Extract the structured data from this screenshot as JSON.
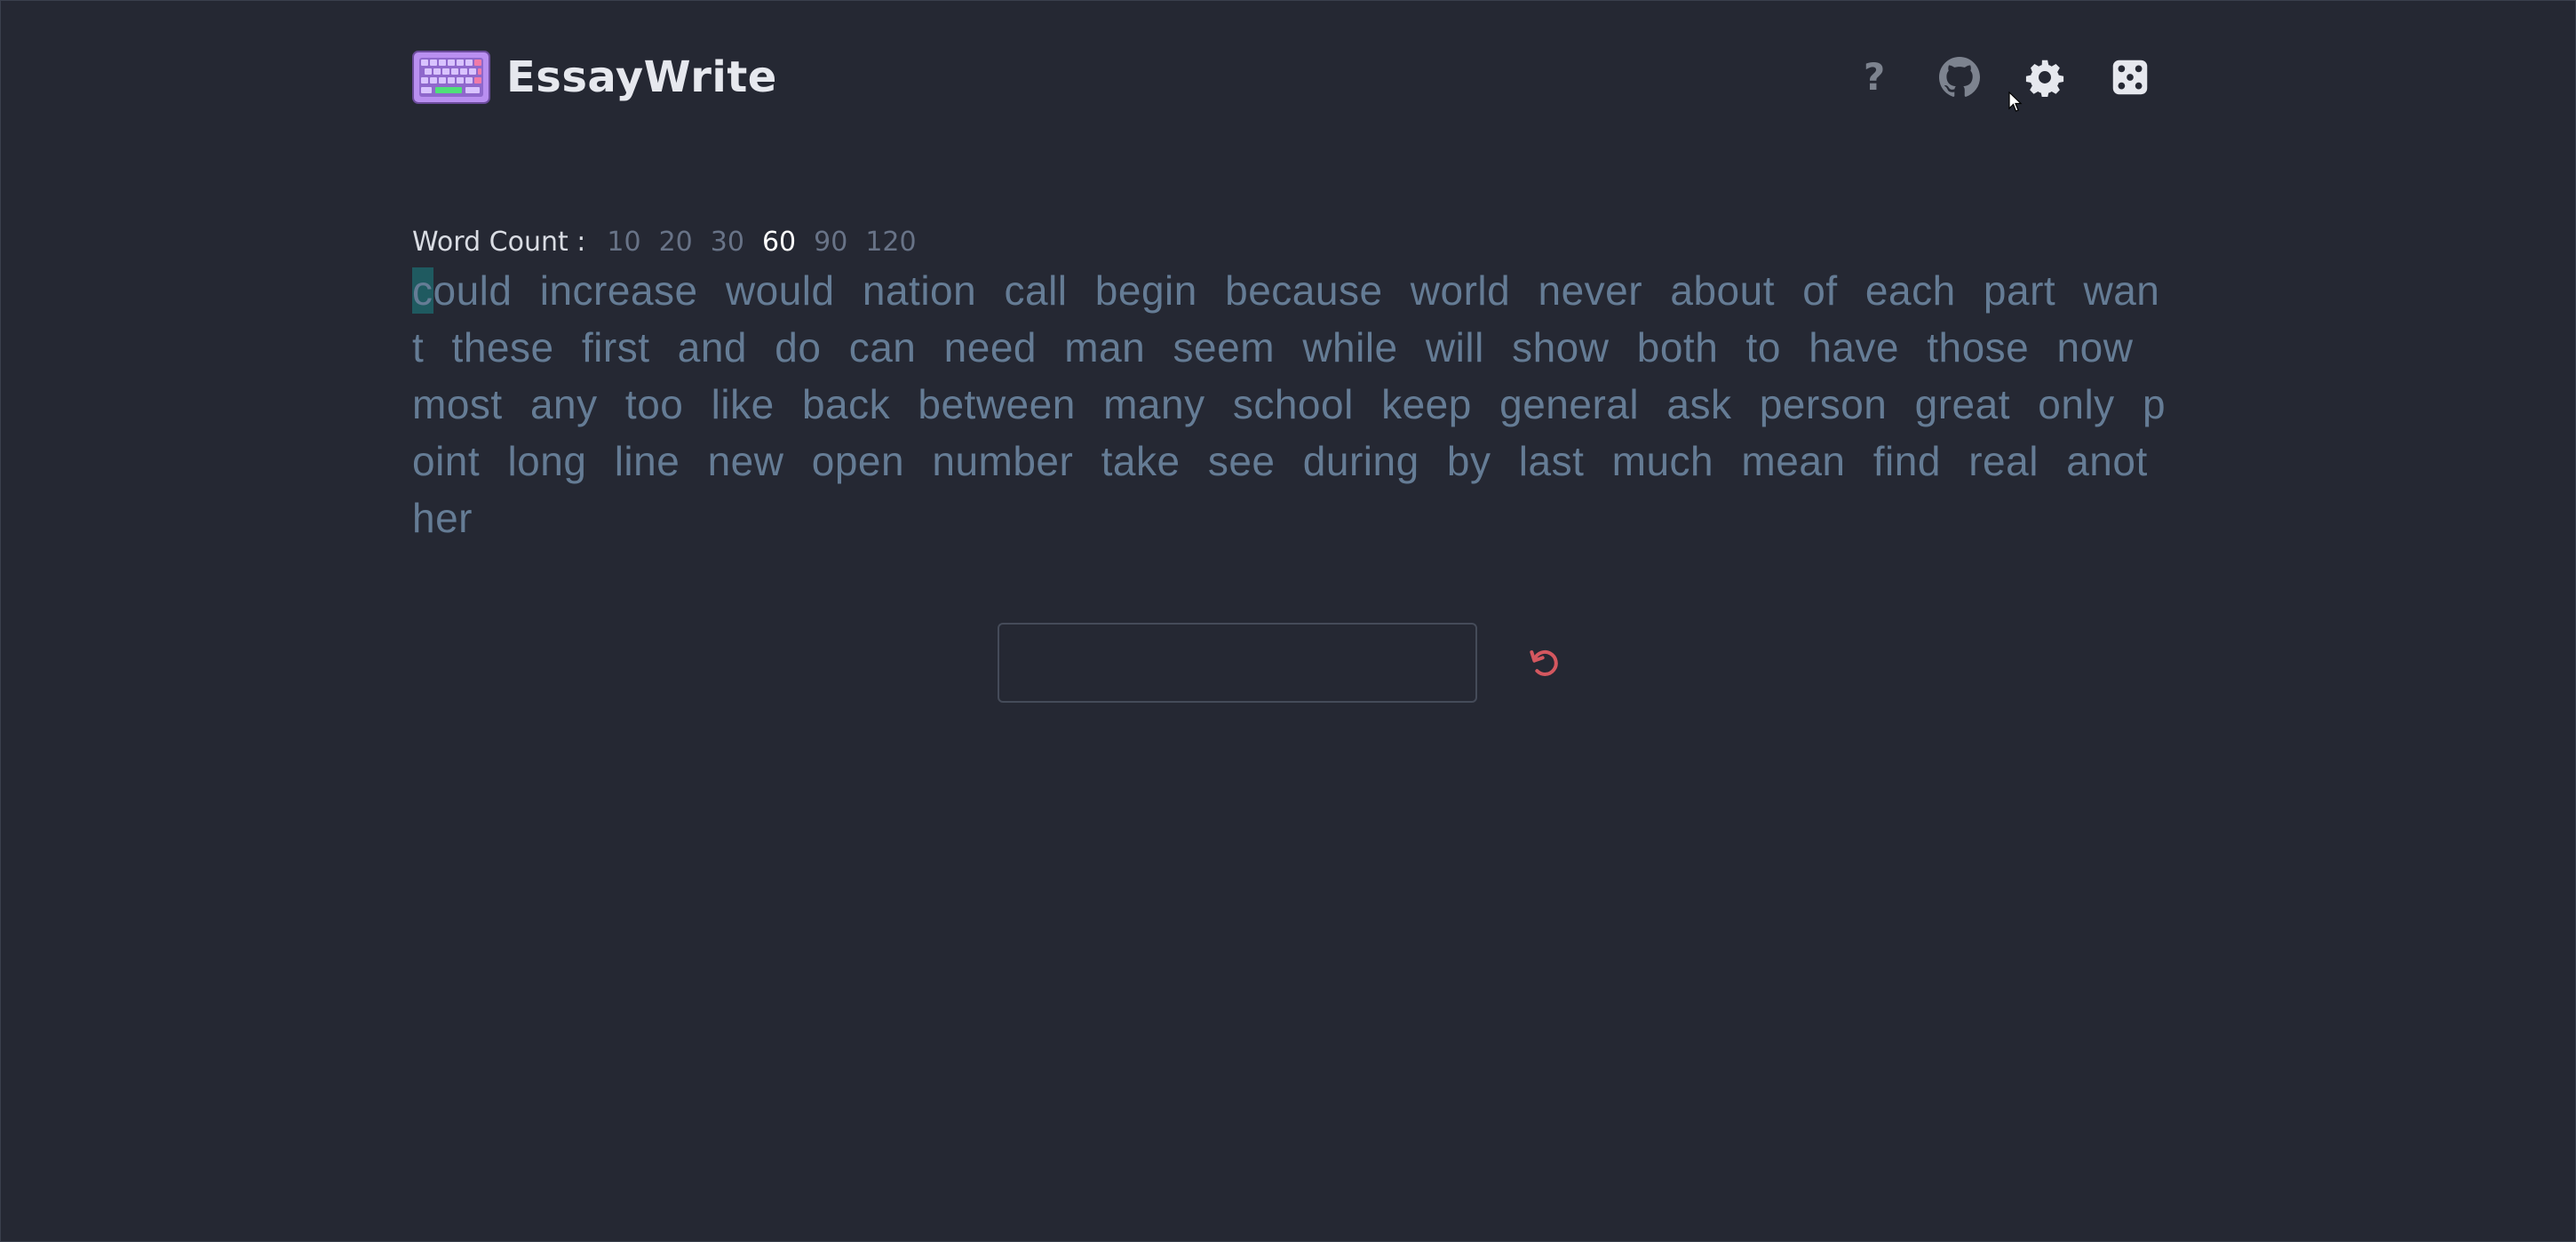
{
  "header": {
    "app_name": "EssayWrite",
    "icons": [
      "keyboard-logo-icon",
      "help-icon",
      "github-icon",
      "gear-icon",
      "dice-icon"
    ],
    "help_glyph": "?"
  },
  "word_count": {
    "label": "Word Count :",
    "options": [
      "10",
      "20",
      "30",
      "60",
      "90",
      "120"
    ],
    "selected": "60"
  },
  "text": {
    "first_char": "c",
    "rest": "ould increase would nation call begin because world never about of each part want these first and do can need man seem while will show both to have those now most any too like back between many school keep general ask person great only point long line new open number take see during by last much mean find real another"
  },
  "input": {
    "value": "",
    "placeholder": ""
  },
  "colors": {
    "background": "#252833",
    "text_pending": "#657c95",
    "caret": "#1f5a60",
    "word_count_active": "#ffffff",
    "word_count_inactive": "#687387",
    "reset_icon": "#d4575f"
  }
}
